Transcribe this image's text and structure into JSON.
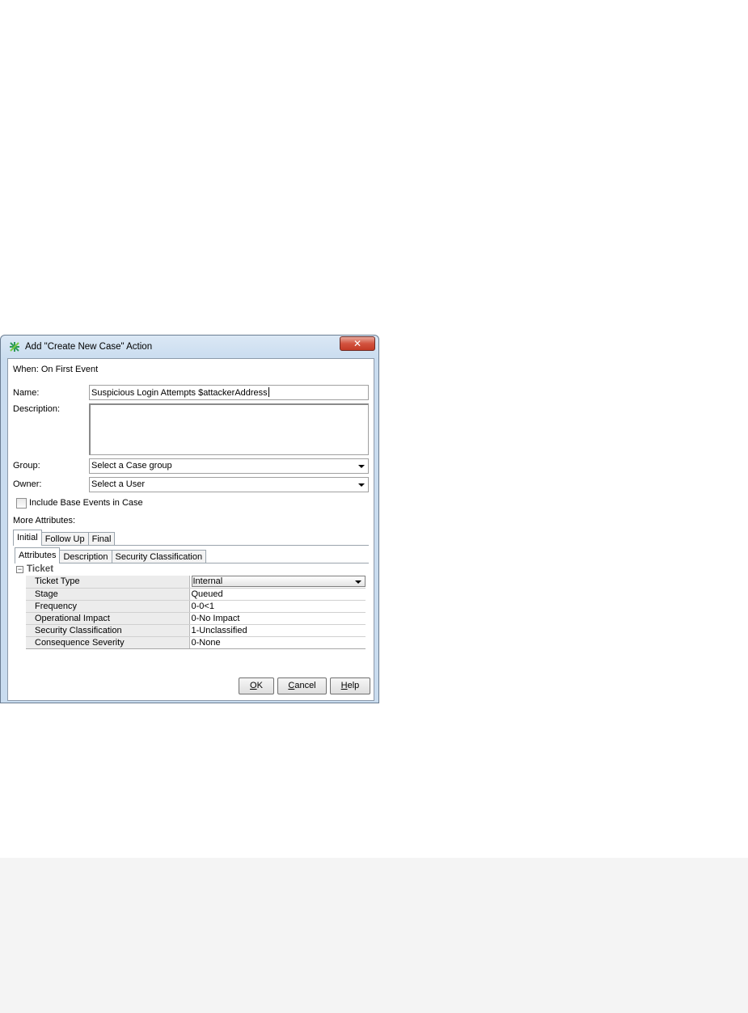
{
  "dialog": {
    "title": "Add \"Create New Case\" Action",
    "close_symbol": "✕",
    "icon": "case-action-icon",
    "when_label": "When: On First Event",
    "name_label": "Name:",
    "name_value": "Suspicious Login Attempts $attackerAddress",
    "description_label": "Description:",
    "description_value": "",
    "group_label": "Group:",
    "group_value": "Select a Case group",
    "owner_label": "Owner:",
    "owner_value": "Select a User",
    "include_base_events_label": "Include Base Events in Case",
    "include_base_events_checked": false,
    "more_attributes_label": "More Attributes:"
  },
  "outer_tabs": [
    {
      "label": "Initial",
      "active": true
    },
    {
      "label": "Follow Up",
      "active": false
    },
    {
      "label": "Final",
      "active": false
    }
  ],
  "inner_tabs": [
    {
      "label": "Attributes",
      "active": true
    },
    {
      "label": "Description",
      "active": false
    },
    {
      "label": "Security Classification",
      "active": false
    }
  ],
  "ticket": {
    "section_label": "Ticket",
    "collapse_symbol": "−",
    "rows": [
      {
        "key": "Ticket Type",
        "value": "Internal"
      },
      {
        "key": "Stage",
        "value": "Queued"
      },
      {
        "key": "Frequency",
        "value": "0-0<1"
      },
      {
        "key": "Operational Impact",
        "value": "0-No Impact"
      },
      {
        "key": "Security Classification",
        "value": "1-Unclassified"
      },
      {
        "key": "Consequence Severity",
        "value": "0-None"
      }
    ]
  },
  "buttons": {
    "ok_mnemonic": "O",
    "ok_rest": "K",
    "cancel_mnemonic": "C",
    "cancel_rest": "ancel",
    "help_mnemonic": "H",
    "help_rest": "elp"
  },
  "colors": {
    "title_gradient_top": "#dbe8f5",
    "title_gradient_bottom": "#c9dcef",
    "close_button": "#c43a26",
    "background_panel": "#f4f4f4"
  }
}
